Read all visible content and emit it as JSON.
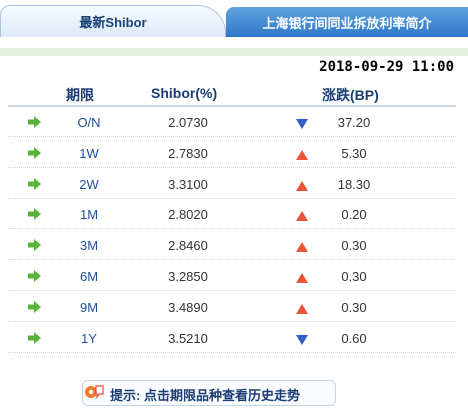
{
  "tabs": {
    "active_label": "最新Shibor",
    "inactive_label": "上海银行间同业拆放利率简介"
  },
  "timestamp": "2018-09-29 11:00",
  "table": {
    "headers": {
      "term": "期限",
      "rate": "Shibor(%)",
      "change": "涨跌(BP)"
    },
    "rows": [
      {
        "term": "O/N",
        "rate": "2.0730",
        "direction": "down",
        "bp": "37.20"
      },
      {
        "term": "1W",
        "rate": "2.7830",
        "direction": "up",
        "bp": "5.30"
      },
      {
        "term": "2W",
        "rate": "3.3100",
        "direction": "up",
        "bp": "18.30"
      },
      {
        "term": "1M",
        "rate": "2.8020",
        "direction": "up",
        "bp": "0.20"
      },
      {
        "term": "3M",
        "rate": "2.8460",
        "direction": "up",
        "bp": "0.30"
      },
      {
        "term": "6M",
        "rate": "3.2850",
        "direction": "up",
        "bp": "0.30"
      },
      {
        "term": "9M",
        "rate": "3.4890",
        "direction": "up",
        "bp": "0.30"
      },
      {
        "term": "1Y",
        "rate": "3.5210",
        "direction": "down",
        "bp": "0.60"
      }
    ]
  },
  "tip": {
    "label": "提示:",
    "text": "点击期限品种查看历史走势"
  },
  "colors": {
    "up": "#e8553a",
    "down": "#2f5fc6",
    "arrow": "#58b43a",
    "tab_active_text": "#1a3f78",
    "tab_inactive_bg": "#3d86d2"
  },
  "icons": {
    "row_arrow": "green-right-arrow-icon",
    "up": "red-up-triangle-icon",
    "down": "blue-down-triangle-icon",
    "tip": "hint-bubble-icon"
  }
}
